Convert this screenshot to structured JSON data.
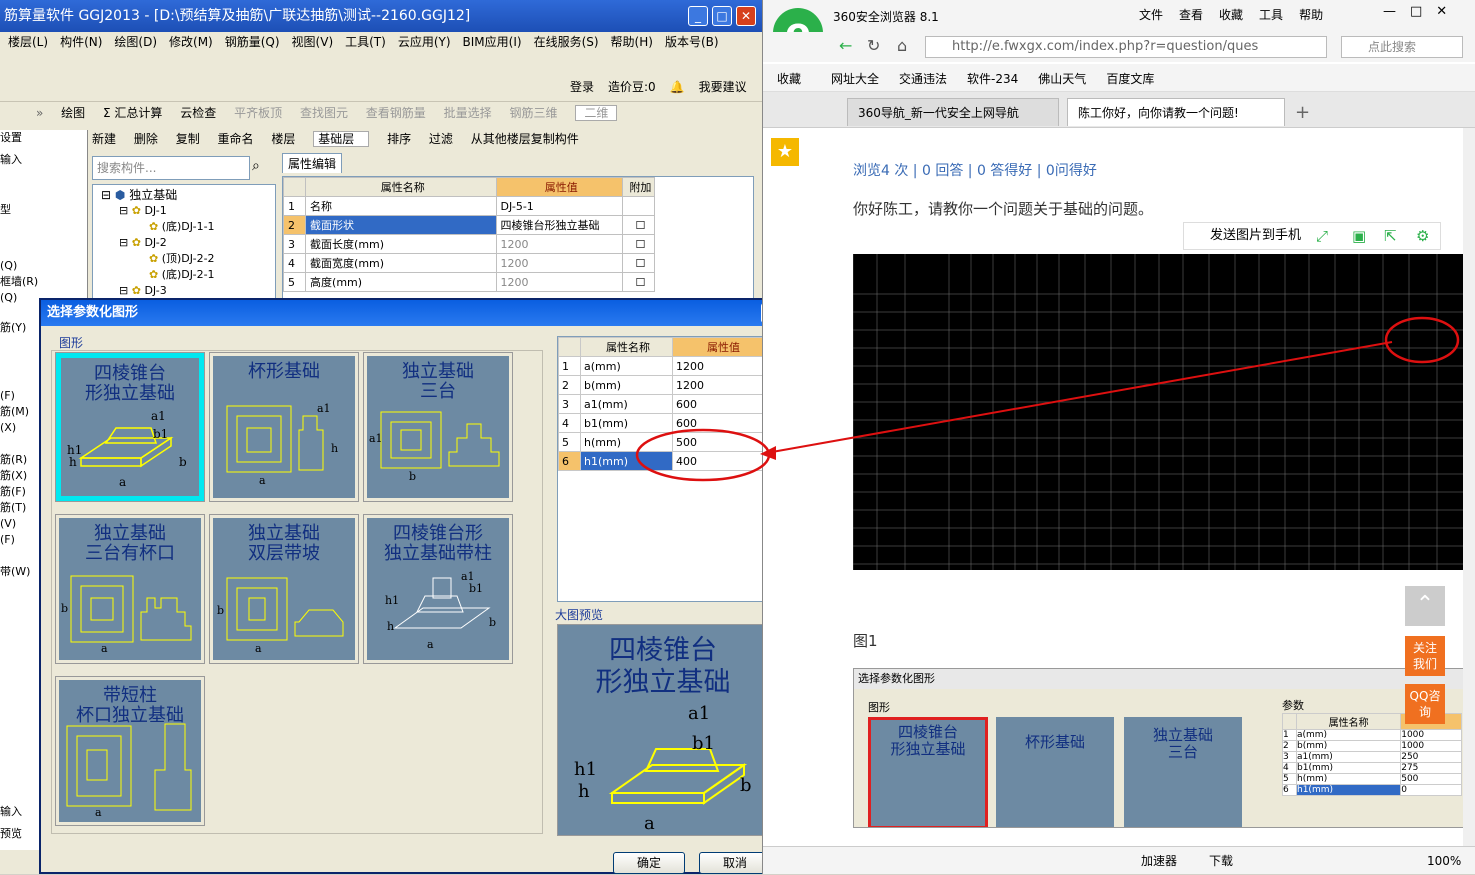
{
  "app": {
    "title": "筋算量软件 GGJ2013 - [D:\\预结算及抽筋\\广联达抽筋\\测试--2160.GGJ12]",
    "menu": [
      "楼层(L)",
      "构件(N)",
      "绘图(D)",
      "修改(M)",
      "钢筋量(Q)",
      "视图(V)",
      "工具(T)",
      "云应用(Y)",
      "BIM应用(I)",
      "在线服务(S)",
      "帮助(H)",
      "版本号(B)"
    ],
    "login": "登录",
    "price_bean": "造价豆:0",
    "suggest": "我要建议",
    "toolbar1": [
      "绘图",
      "Σ 汇总计算",
      "云检查",
      "平齐板顶",
      "查找图元",
      "查看钢筋量",
      "批量选择",
      "钢筋三维"
    ],
    "view_mode": "二维",
    "toolbar2": [
      "新建",
      "删除",
      "复制",
      "重命名",
      "楼层",
      "基础层",
      "排序",
      "过滤",
      "从其他楼层复制构件"
    ],
    "search_placeholder": "搜索构件...",
    "tree": [
      "独立基础",
      "DJ-1",
      "(底)DJ-1-1",
      "DJ-2",
      "(顶)DJ-2-2",
      "(底)DJ-2-1",
      "DJ-3"
    ],
    "left_edge": [
      "设置",
      "输入",
      "",
      "型",
      "",
      "",
      "(Q)",
      "框墙(R)",
      "(Q)",
      "筋(Y)",
      "",
      "",
      "",
      "(F)",
      "筋(M)",
      "(X)",
      "",
      "筋(R)",
      "筋(X)",
      "筋(F)",
      "筋(T)",
      "(V)",
      "(F)",
      "",
      "带(W)"
    ],
    "left_bottom": [
      "输入",
      "预览"
    ],
    "prop_tab": "属性编辑",
    "prop_headers": [
      "属性名称",
      "属性值",
      "附加"
    ],
    "prop_rows": [
      {
        "no": "1",
        "name": "名称",
        "value": "DJ-5-1"
      },
      {
        "no": "2",
        "name": "截面形状",
        "value": "四棱锥台形独立基础"
      },
      {
        "no": "3",
        "name": "截面长度(mm)",
        "value": "1200"
      },
      {
        "no": "4",
        "name": "截面宽度(mm)",
        "value": "1200"
      },
      {
        "no": "5",
        "name": "高度(mm)",
        "value": "1200"
      }
    ]
  },
  "dialog": {
    "title": "选择参数化图形",
    "group_label": "图形",
    "tiles": [
      {
        "name": "四棱锥台形独立基础",
        "line1": "四棱锥台",
        "line2": "形独立基础"
      },
      {
        "name": "杯形基础",
        "line1": "杯形基础",
        "line2": ""
      },
      {
        "name": "独立基础三台",
        "line1": "独立基础",
        "line2": "三台"
      },
      {
        "name": "独立基础三台有杯口",
        "line1": "独立基础",
        "line2": "三台有杯口"
      },
      {
        "name": "独立基础双层带坡",
        "line1": "独立基础",
        "line2": "双层带坡"
      },
      {
        "name": "四棱锥台形独立基础带柱",
        "line1": "四棱锥台形",
        "line2": "独立基础带柱"
      },
      {
        "name": "带短柱杯口独立基础",
        "line1": "带短柱",
        "line2": "杯口独立基础"
      }
    ],
    "param_headers": [
      "属性名称",
      "属性值"
    ],
    "params": [
      {
        "no": "1",
        "name": "a(mm)",
        "value": "1200"
      },
      {
        "no": "2",
        "name": "b(mm)",
        "value": "1200"
      },
      {
        "no": "3",
        "name": "a1(mm)",
        "value": "600"
      },
      {
        "no": "4",
        "name": "b1(mm)",
        "value": "600"
      },
      {
        "no": "5",
        "name": "h(mm)",
        "value": "500"
      },
      {
        "no": "6",
        "name": "h1(mm)",
        "value": "400"
      }
    ],
    "preview_label": "大图预览",
    "preview_line1": "四棱锥台",
    "preview_line2": "形独立基础",
    "ok": "确定",
    "cancel": "取消",
    "dim_labels": {
      "a": "a",
      "b": "b",
      "a1": "a1",
      "b1": "b1",
      "h": "h",
      "h1": "h1"
    }
  },
  "browser": {
    "name": "360安全浏览器 8.1",
    "menu": [
      "文件",
      "查看",
      "收藏",
      "工具",
      "帮助"
    ],
    "url": "http://e.fwxgx.com/index.php?r=question/ques",
    "search_placeholder": "点此搜索",
    "favorites": [
      "收藏",
      "网址大全",
      "交通违法",
      "软件-234",
      "佛山天气",
      "百度文库"
    ],
    "tabs": [
      "360导航_新一代安全上网导航",
      "陈工你好，向你请教一个问题!"
    ],
    "stats": "浏览4 次 | 0 回答 | 0 答得好 | 0问得好",
    "question": "你好陈工，请教你一个问题关于基础的问题。",
    "send_to_phone": "发送图片到手机",
    "fig1": "图1",
    "follow": "关注我们",
    "qq": "QQ咨询",
    "status": [
      "加速器",
      "下载",
      "100%"
    ],
    "embedded_dialog": {
      "title": "选择参数化图形",
      "group": "图形",
      "params_label": "参数",
      "headers": [
        "属性名称"
      ],
      "rows": [
        {
          "no": "1",
          "name": "a(mm)",
          "value": "1000"
        },
        {
          "no": "2",
          "name": "b(mm)",
          "value": "1000"
        },
        {
          "no": "3",
          "name": "a1(mm)",
          "value": "250"
        },
        {
          "no": "4",
          "name": "b1(mm)",
          "value": "275"
        },
        {
          "no": "5",
          "name": "h(mm)",
          "value": "500"
        },
        {
          "no": "6",
          "name": "h1(mm)",
          "value": "0"
        }
      ]
    }
  },
  "colors": {
    "accent_red": "#dd1010",
    "selection_cyan": "#00e8f0",
    "tile_bg": "#6d8aa3",
    "header_orange": "#f5c26b"
  }
}
